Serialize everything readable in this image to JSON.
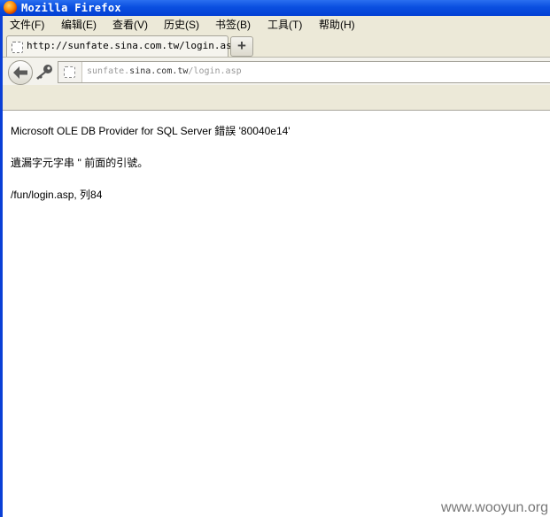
{
  "window": {
    "title": "Mozilla Firefox"
  },
  "menu": [
    "文件(F)",
    "编辑(E)",
    "查看(V)",
    "历史(S)",
    "书签(B)",
    "工具(T)",
    "帮助(H)"
  ],
  "tab": {
    "title": "http://sunfate.sina.com.tw/login.asp",
    "new_tab_symbol": "+"
  },
  "urlbar": {
    "url_prefix": "sunfate.",
    "url_domain": "sina.com.tw",
    "url_path": "/login.asp"
  },
  "page": {
    "error_line": "Microsoft OLE DB Provider for SQL Server 錯誤 '80040e14'",
    "detail_line": "遺漏字元字串 '' 前面的引號。",
    "location_line": "/fun/login.asp, 列84"
  },
  "watermark": "www.wooyun.org"
}
